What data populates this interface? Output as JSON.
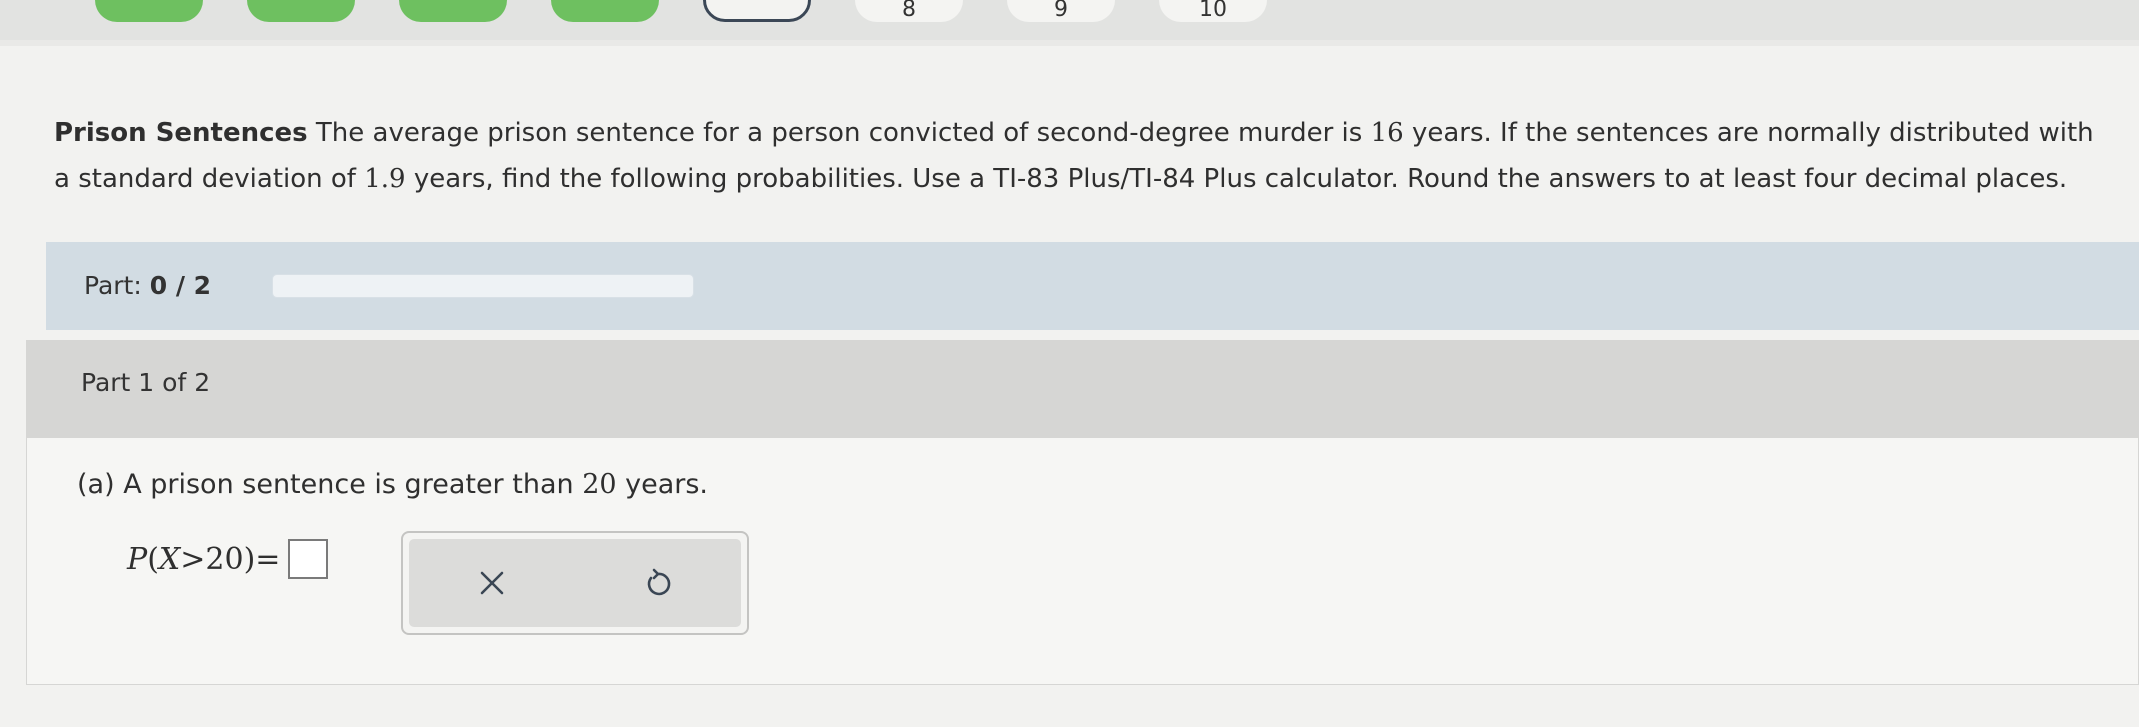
{
  "top_steps": {
    "items": [
      {
        "state": "done",
        "label": ""
      },
      {
        "state": "done",
        "label": ""
      },
      {
        "state": "done",
        "label": ""
      },
      {
        "state": "done",
        "label": ""
      },
      {
        "state": "current",
        "label": ""
      },
      {
        "state": "todo",
        "label": "8"
      },
      {
        "state": "todo",
        "label": "9"
      },
      {
        "state": "todo",
        "label": "10"
      }
    ]
  },
  "problem": {
    "title": "Prison Sentences",
    "text_1": " The average prison sentence for a person convicted of second-degree murder is ",
    "mean": "16",
    "text_2": " years. If the sentences are normally distributed with a standard deviation of ",
    "sd": "1.9",
    "text_3": " years, find the following probabilities. Use a TI-83 Plus/TI-84 Plus calculator. Round the answers to at least four decimal places."
  },
  "part_progress": {
    "label": "Part: ",
    "value": "0 / 2",
    "fraction": 0
  },
  "part_card": {
    "header": "Part 1 of 2",
    "question_prefix": "(a) A prison sentence is greater than ",
    "question_value": "20",
    "question_suffix": " years."
  },
  "equation": {
    "p": "P",
    "open": "(",
    "var": "X",
    "rest": ">20)",
    "equals": "="
  },
  "actions": {
    "clear_icon": "x-icon",
    "undo_icon": "undo-icon"
  },
  "colors": {
    "done": "#6ec060",
    "part_bar": "#d2dce3",
    "card_header": "#d6d6d4"
  }
}
